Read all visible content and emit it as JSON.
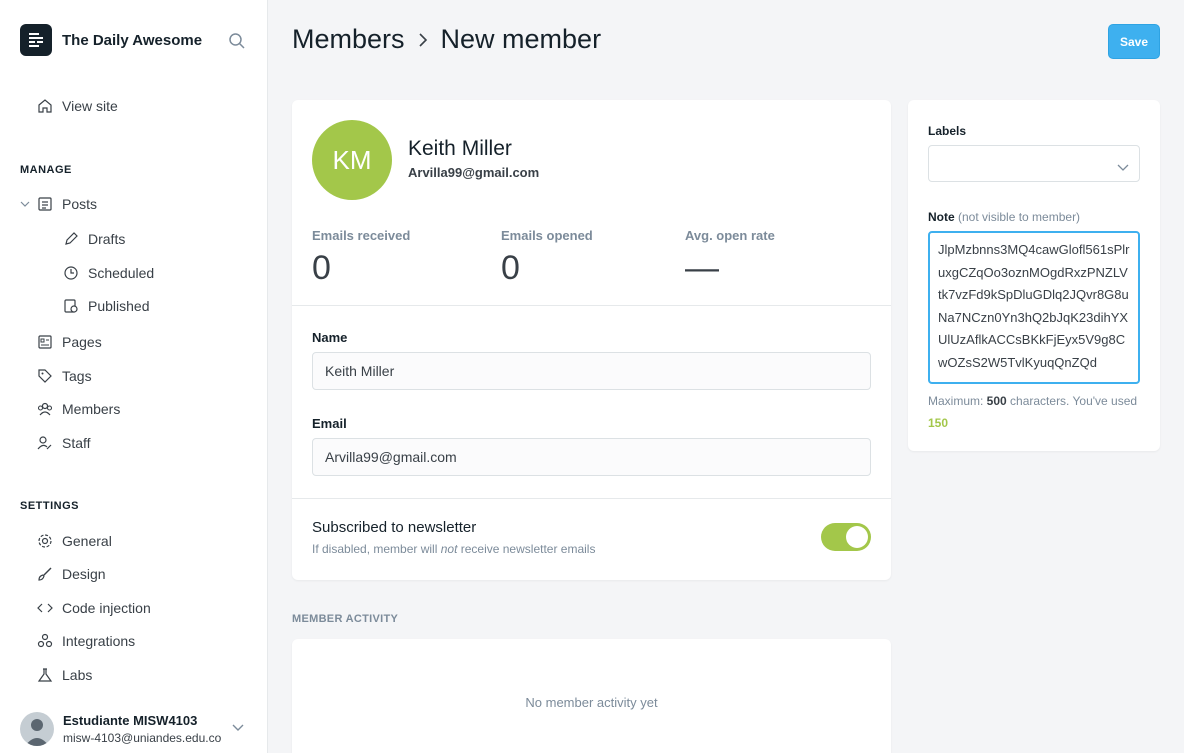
{
  "brand": {
    "title": "The Daily Awesome"
  },
  "sidebar": {
    "view_site": "View site",
    "manage_label": "MANAGE",
    "posts": "Posts",
    "drafts": "Drafts",
    "scheduled": "Scheduled",
    "published": "Published",
    "pages": "Pages",
    "tags": "Tags",
    "members": "Members",
    "staff": "Staff",
    "settings_label": "SETTINGS",
    "general": "General",
    "design": "Design",
    "code_injection": "Code injection",
    "integrations": "Integrations",
    "labs": "Labs"
  },
  "user": {
    "name": "Estudiante MISW4103",
    "email": "misw-4103@uniandes.edu.co"
  },
  "header": {
    "crumb_parent": "Members",
    "crumb_current": "New member",
    "save_label": "Save"
  },
  "member": {
    "initials": "KM",
    "name": "Keith Miller",
    "email": "Arvilla99@gmail.com",
    "stats": {
      "received_label": "Emails received",
      "received_value": "0",
      "opened_label": "Emails opened",
      "opened_value": "0",
      "rate_label": "Avg. open rate",
      "rate_value": "—"
    }
  },
  "form": {
    "name_label": "Name",
    "name_value": "Keith Miller",
    "email_label": "Email",
    "email_value": "Arvilla99@gmail.com",
    "newsletter_title": "Subscribed to newsletter",
    "newsletter_desc_pre": "If disabled, member will ",
    "newsletter_desc_em": "not",
    "newsletter_desc_post": " receive newsletter emails",
    "newsletter_on": true
  },
  "activity": {
    "label": "MEMBER ACTIVITY",
    "empty": "No member activity yet"
  },
  "side": {
    "labels_label": "Labels",
    "note_label": "Note",
    "note_hint": "(not visible to member)",
    "note_value": "JlpMzbnns3MQ4cawGlofl561sPlruxgCZqOo3oznMOgdRxzPNZLVtk7vzFd9kSpDluGDlq2JQvr8G8uNa7NCzn0Yn3hQ2bJqK23dihYXUlUzAflkACCsBKkFjEyx5V9g8CwOZsS2W5TvlKyuqQnZQd",
    "help_pre": "Maximum: ",
    "help_max": "500",
    "help_mid": " characters. You've used ",
    "help_used": "150"
  },
  "colors": {
    "accent": "#3eb0ef",
    "green": "#a3c74a",
    "text": "#15212a"
  }
}
